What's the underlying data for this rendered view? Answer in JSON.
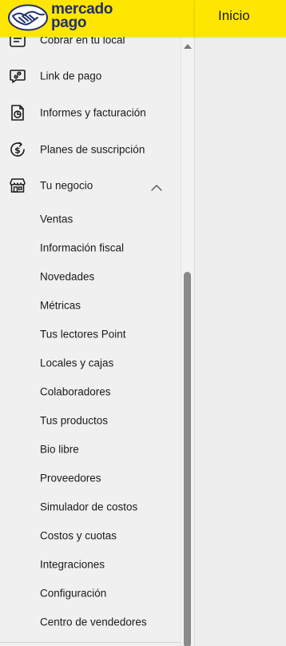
{
  "brand": {
    "line1": "mercado",
    "line2": "pago"
  },
  "header": {
    "title": "Inicio"
  },
  "sidebar": {
    "items": [
      {
        "label": "Cobrar en tu local",
        "icon": "store-receipt-icon"
      },
      {
        "label": "Link de pago",
        "icon": "link-icon"
      },
      {
        "label": "Informes y facturación",
        "icon": "report-icon"
      },
      {
        "label": "Planes de suscripción",
        "icon": "subscription-icon"
      },
      {
        "label": "Tu negocio",
        "icon": "storefront-icon",
        "expanded": true
      }
    ],
    "subitems": [
      "Ventas",
      "Información fiscal",
      "Novedades",
      "Métricas",
      "Tus lectores Point",
      "Locales y cajas",
      "Colaboradores",
      "Tus productos",
      "Bio libre",
      "Proveedores",
      "Simulador de costos",
      "Costos y cuotas",
      "Integraciones",
      "Configuración",
      "Centro de vendedores"
    ]
  },
  "colors": {
    "brand_yellow": "#ffe600",
    "brand_blue": "#20306e",
    "sidebar_bg": "#f0f0f0"
  }
}
